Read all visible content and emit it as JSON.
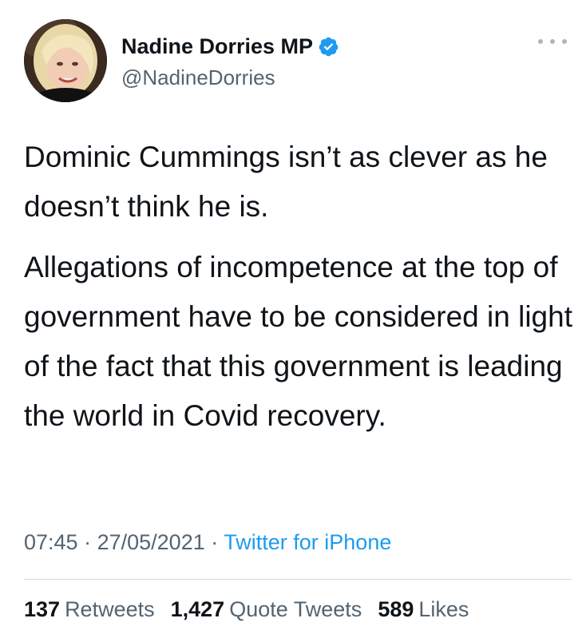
{
  "author": {
    "display_name": "Nadine Dorries MP",
    "handle": "@NadineDorries",
    "verified_icon": "verified-badge-icon",
    "avatar": "profile-photo"
  },
  "tweet": {
    "paragraphs": [
      "Dominic Cummings isn’t as clever as he doesn’t think he is.",
      "Allegations of incompetence at the top of government have to be considered in light of the fact that this government is leading the world in Covid recovery."
    ],
    "time": "07:45",
    "date": "27/05/2021",
    "separator": "·",
    "source": "Twitter for iPhone"
  },
  "stats": {
    "retweets": {
      "count": "137",
      "label": "Retweets"
    },
    "quote_tweets": {
      "count": "1,427",
      "label": "Quote Tweets"
    },
    "likes": {
      "count": "589",
      "label": "Likes"
    }
  },
  "colors": {
    "text_primary": "#0f1419",
    "text_secondary": "#536471",
    "link": "#1d9bf0",
    "verified": "#1d9bf0",
    "divider": "#cfd9de"
  },
  "icons": {
    "more": "more-options-icon"
  }
}
